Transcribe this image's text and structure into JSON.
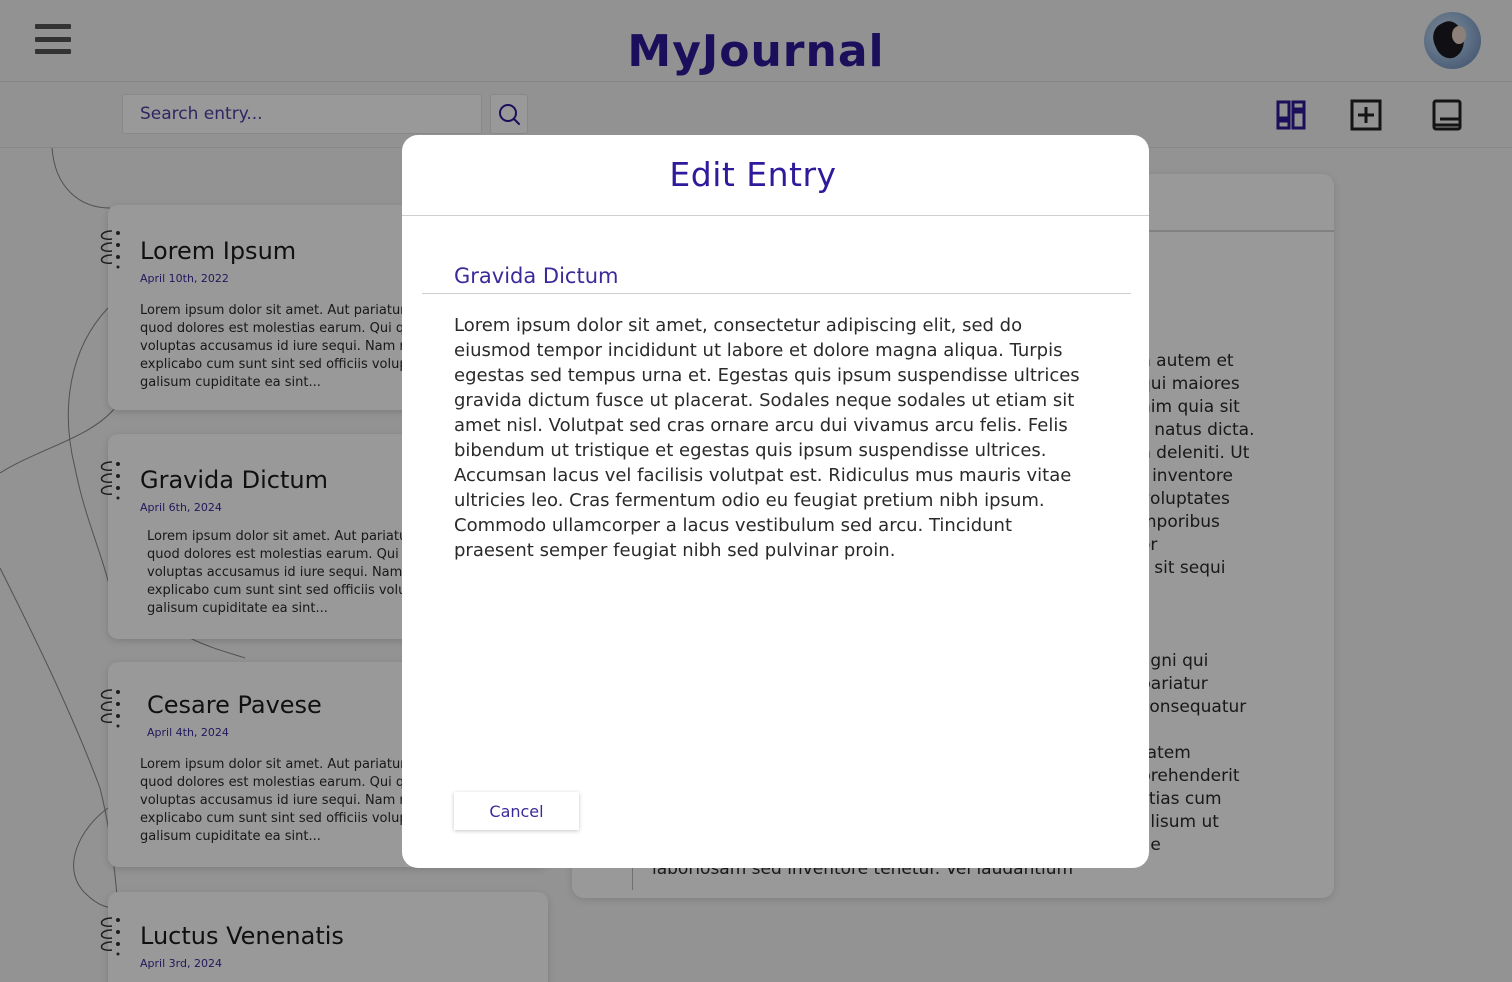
{
  "header": {
    "app_title": "MyJournal",
    "menu_icon": "hamburger-menu-icon",
    "avatar_icon": "user-avatar"
  },
  "toolbar": {
    "search_placeholder": "Search entry...",
    "search_icon": "search-icon",
    "tools": [
      "dashboard-grid-icon",
      "add-entry-icon",
      "book-icon"
    ],
    "accent_color": "#2e1a9a"
  },
  "entries": [
    {
      "title": "Lorem Ipsum",
      "date": "April 10th, 2022",
      "excerpt": [
        "Lorem ipsum dolor sit amet. Aut pariatur",
        "quod dolores est molestias earum. Qui qu",
        "voluptas accusamus id iure sequi. Nam m",
        "explicabo cum sunt sint sed officiis volup",
        "galisum cupiditate ea sint..."
      ]
    },
    {
      "title": "Gravida Dictum",
      "date": "April 6th, 2024",
      "excerpt": [
        "Lorem ipsum dolor sit amet. Aut pariatur",
        "quod dolores est molestias earum. Qui q",
        "voluptas accusamus id iure sequi. Nam m",
        "explicabo cum sunt sint sed officiis volup",
        "galisum cupiditate ea sint..."
      ]
    },
    {
      "title": "Cesare Pavese",
      "date": "April 4th, 2024",
      "excerpt": [
        "Lorem ipsum dolor sit amet. Aut pariatur",
        "quod dolores est molestias earum. Qui qu",
        "voluptas accusamus id iure sequi. Nam m",
        "explicabo cum sunt sint sed officiis volup",
        "galisum cupiditate ea sint..."
      ]
    },
    {
      "title": "Luctus Venenatis",
      "date": "April 3rd, 2024",
      "excerpt": []
    }
  ],
  "detail": {
    "paragraph1": [
      "n autem et",
      "qui maiores",
      "nim quia sit",
      "s natus dicta.",
      "n deleniti. Ut",
      "t inventore",
      "voluptates",
      "mporibus",
      "or",
      "s sit sequi"
    ],
    "paragraph2": [
      "agni qui",
      "pariatur",
      "consequatur",
      "a",
      "tatem",
      "prehenderit",
      "stias cum",
      "alisum ut",
      "ae"
    ],
    "bottom_line": "laboriosam sed inventore tenetur. Vel laudantium"
  },
  "modal": {
    "title": "Edit Entry",
    "entry_title_value": "Gravida Dictum",
    "body_text": "Lorem ipsum dolor sit amet, consectetur adipiscing elit, sed do\neiusmod tempor incididunt ut labore et dolore magna aliqua. Turpis\negestas sed tempus urna et. Egestas quis ipsum suspendisse ultrices\ngravida dictum fusce ut placerat. Sodales neque sodales ut etiam sit\namet nisl. Volutpat sed cras ornare arcu dui vivamus arcu felis. Felis\nbibendum ut tristique et egestas quis ipsum suspendisse ultrices.\nAccumsan lacus vel facilisis volutpat est. Ridiculus mus mauris vitae\nultricies leo. Cras fermentum odio eu feugiat pretium nibh ipsum.\nCommodo ullamcorper a lacus vestibulum sed arcu. Tincidunt\npraesent semper feugiat nibh sed pulvinar proin.",
    "cancel_label": "Cancel"
  }
}
